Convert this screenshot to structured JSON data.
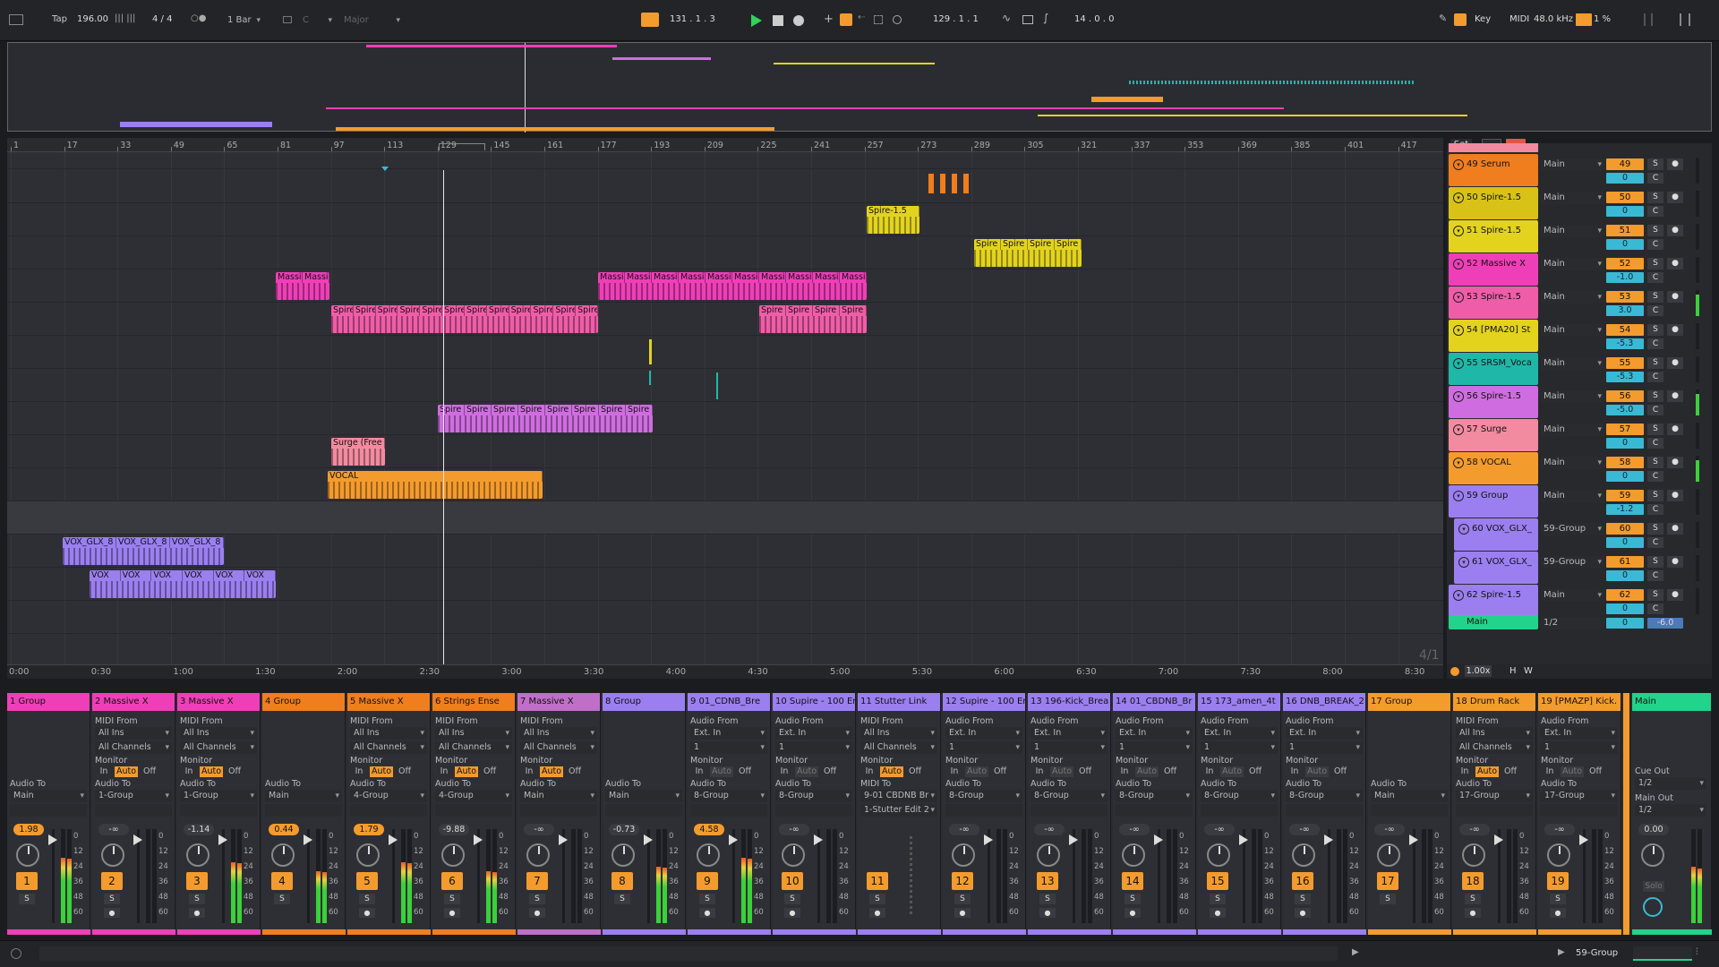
{
  "toolbar": {
    "tap": "Tap",
    "tempo": "196.00",
    "time_signature": "4 / 4",
    "quantize": "1 Bar",
    "key_root": "C",
    "key_scale": "Major",
    "position": "131 .   1 .   3",
    "loop_start": "129 .   1 .   1",
    "loop_length": "14 .   0 .   0",
    "key_label": "Key",
    "midi_label": "MIDI",
    "sample_rate": "48.0 kHz",
    "cpu": "1 %"
  },
  "bar_ruler": [
    "1",
    "17",
    "33",
    "49",
    "65",
    "81",
    "97",
    "113",
    "129",
    "145",
    "161",
    "177",
    "193",
    "209",
    "225",
    "241",
    "257",
    "273",
    "289",
    "305",
    "321",
    "337",
    "353",
    "369",
    "385",
    "401",
    "417"
  ],
  "set_label": "Set",
  "time_ruler": [
    "0:00",
    "0:30",
    "1:00",
    "1:30",
    "2:00",
    "2:30",
    "3:00",
    "3:30",
    "4:00",
    "4:30",
    "5:00",
    "5:30",
    "6:00",
    "6:30",
    "7:00",
    "7:30",
    "8:00",
    "8:30"
  ],
  "zoom_overlay": "4/1",
  "tracks": [
    {
      "name": "49 Serum",
      "route": "Main",
      "num": "49",
      "vol": "0",
      "color": "#f07d1e"
    },
    {
      "name": "50 Spire-1.5",
      "route": "Main",
      "num": "50",
      "vol": "0",
      "color": "#d8c218"
    },
    {
      "name": "51 Spire-1.5",
      "route": "Main",
      "num": "51",
      "vol": "0",
      "color": "#e3d31f"
    },
    {
      "name": "52 Massive X",
      "route": "Main",
      "num": "52",
      "vol": "-1.0",
      "color": "#ef3fb8"
    },
    {
      "name": "53 Spire-1.5",
      "route": "Main",
      "num": "53",
      "vol": "3.0",
      "color": "#ef5da8"
    },
    {
      "name": "54 [PMA20] St",
      "route": "Main",
      "num": "54",
      "vol": "-5.3",
      "color": "#e3d31f"
    },
    {
      "name": "55 SRSM_Voca",
      "route": "Main",
      "num": "55",
      "vol": "-5.3",
      "color": "#1fb8a8"
    },
    {
      "name": "56 Spire-1.5",
      "route": "Main",
      "num": "56",
      "vol": "-5.0",
      "color": "#cf6de0"
    },
    {
      "name": "57 Surge",
      "route": "Main",
      "num": "57",
      "vol": "0",
      "color": "#f28aa0"
    },
    {
      "name": "58 VOCAL",
      "route": "Main",
      "num": "58",
      "vol": "0",
      "color": "#f49b2d"
    },
    {
      "name": "59 Group",
      "route": "Main",
      "num": "59",
      "vol": "-1.2",
      "color": "#9b7ff0"
    },
    {
      "name": "60 VOX_GLX_",
      "route": "59-Group",
      "num": "60",
      "vol": "0",
      "color": "#9b7ff0"
    },
    {
      "name": "61 VOX_GLX_",
      "route": "59-Group",
      "num": "61",
      "vol": "0",
      "color": "#9b7ff0"
    },
    {
      "name": "62 Spire-1.5",
      "route": "Main",
      "num": "62",
      "vol": "0",
      "color": "#9b7ff0"
    }
  ],
  "main_track": {
    "name": "Main",
    "route": "1/2",
    "vol": "0",
    "vol2": "-6.0",
    "color": "#22d38b"
  },
  "clips": [
    {
      "lane": 3,
      "label": "Massi",
      "start": 0,
      "count": 2
    },
    {
      "lane": 1,
      "label": "Spire-1.5",
      "start": 0,
      "count": 1
    },
    {
      "lane": 2,
      "label": "Spire",
      "start": 0,
      "count": 4
    },
    {
      "lane": 4,
      "label": "Spire",
      "start": 0,
      "count": 10
    },
    {
      "lane": 7,
      "label": "Spire",
      "start": 0,
      "count": 8
    },
    {
      "lane": 8,
      "label": "Surge (Free",
      "start": 0,
      "count": 1
    },
    {
      "lane": 9,
      "label": "VOCAL",
      "start": 0,
      "count": 1
    },
    {
      "lane": 11,
      "label": "VOX_GLX_8",
      "start": 0,
      "count": 3
    },
    {
      "lane": 12,
      "label": "VOX",
      "start": 0,
      "count": 6
    }
  ],
  "clip_labels": {
    "massive_a": "Massi",
    "massive_b": "Massi",
    "spire_15": "Spire-1.5",
    "spire": "Spire",
    "surge": "Surge (Free",
    "vocal": "VOCAL",
    "vox_glx": "VOX_GLX_8",
    "vox": "VOX",
    "vox_last": "VOX_GLX_8"
  },
  "mixer": {
    "strips": [
      {
        "name": "1 Group",
        "type": "group",
        "vol": "1.98",
        "num": "1",
        "color": "#ef3fb8"
      },
      {
        "name": "2 Massive X",
        "type": "midi",
        "vol": "-∞",
        "num": "2",
        "color": "#ef3fb8",
        "to": "1-Group"
      },
      {
        "name": "3 Massive X",
        "type": "midi",
        "vol": "-1.14",
        "num": "3",
        "color": "#ef3fb8",
        "to": "1-Group"
      },
      {
        "name": "4 Group",
        "type": "group",
        "vol": "0.44",
        "num": "4",
        "color": "#f07d1e"
      },
      {
        "name": "5 Massive X",
        "type": "midi",
        "vol": "1.79",
        "num": "5",
        "color": "#f07d1e",
        "to": "4-Group"
      },
      {
        "name": "6 Strings Ense",
        "type": "midi",
        "vol": "-9.88",
        "num": "6",
        "color": "#f07d1e",
        "to": "4-Group"
      },
      {
        "name": "7 Massive X",
        "type": "midi",
        "vol": "-∞",
        "num": "7",
        "color": "#c06fc8",
        "to": "Main"
      },
      {
        "name": "8 Group",
        "type": "group",
        "vol": "-0.73",
        "num": "8",
        "color": "#9b7ff0"
      },
      {
        "name": "9 01_CDNB_Bre",
        "type": "audio",
        "vol": "4.58",
        "num": "9",
        "color": "#9b7ff0",
        "to": "8-Group"
      },
      {
        "name": "10 Supire - 100 En",
        "type": "audio",
        "vol": "-∞",
        "num": "10",
        "color": "#9b7ff0",
        "to": "8-Group"
      },
      {
        "name": "11 Stutter Link",
        "type": "midiout",
        "vol": "",
        "num": "11",
        "color": "#9b7ff0",
        "to": "9-01 CBDNB Br"
      },
      {
        "name": "12 Supire - 100 En",
        "type": "audio",
        "vol": "-∞",
        "num": "12",
        "color": "#9b7ff0",
        "to": "8-Group"
      },
      {
        "name": "13 196-Kick_Brea",
        "type": "audio",
        "vol": "-∞",
        "num": "13",
        "color": "#9b7ff0",
        "to": "8-Group"
      },
      {
        "name": "14 01_CBDNB_Br",
        "type": "audio",
        "vol": "-∞",
        "num": "14",
        "color": "#9b7ff0",
        "to": "8-Group"
      },
      {
        "name": "15 173_amen_4t",
        "type": "audio",
        "vol": "-∞",
        "num": "15",
        "color": "#9b7ff0",
        "to": "8-Group"
      },
      {
        "name": "16 DNB_BREAK_2",
        "type": "audio",
        "vol": "-∞",
        "num": "16",
        "color": "#9b7ff0",
        "to": "8-Group"
      },
      {
        "name": "17 Group",
        "type": "group",
        "vol": "-∞",
        "num": "17",
        "color": "#f49b2d"
      },
      {
        "name": "18 Drum Rack",
        "type": "midi",
        "vol": "-∞",
        "num": "18",
        "color": "#f49b2d",
        "to": "17-Group"
      },
      {
        "name": "19 [PMAZP] Kick.",
        "type": "audio",
        "vol": "-∞",
        "num": "19",
        "color": "#f49b2d",
        "to": "17-Group"
      }
    ],
    "labels": {
      "midi_from": "MIDI From",
      "audio_from": "Audio From",
      "all_ins": "All Ins",
      "ext_in": "Ext. In",
      "all_channels": "All Channels",
      "channel_1": "1",
      "monitor": "Monitor",
      "in": "In",
      "auto": "Auto",
      "off": "Off",
      "audio_to": "Audio To",
      "midi_to": "MIDI To",
      "main": "Main",
      "stutter_edit": "1-Stutter Edit 2",
      "solo": "S",
      "scale": [
        "0",
        "12",
        "24",
        "36",
        "48",
        "60"
      ]
    },
    "master": {
      "name": "Main",
      "cue_out": "Cue Out",
      "cue_value": "1/2",
      "main_out": "Main Out",
      "main_value": "1/2",
      "vol": "0.00",
      "solo": "Solo"
    }
  },
  "status": {
    "right": "59-Group"
  }
}
